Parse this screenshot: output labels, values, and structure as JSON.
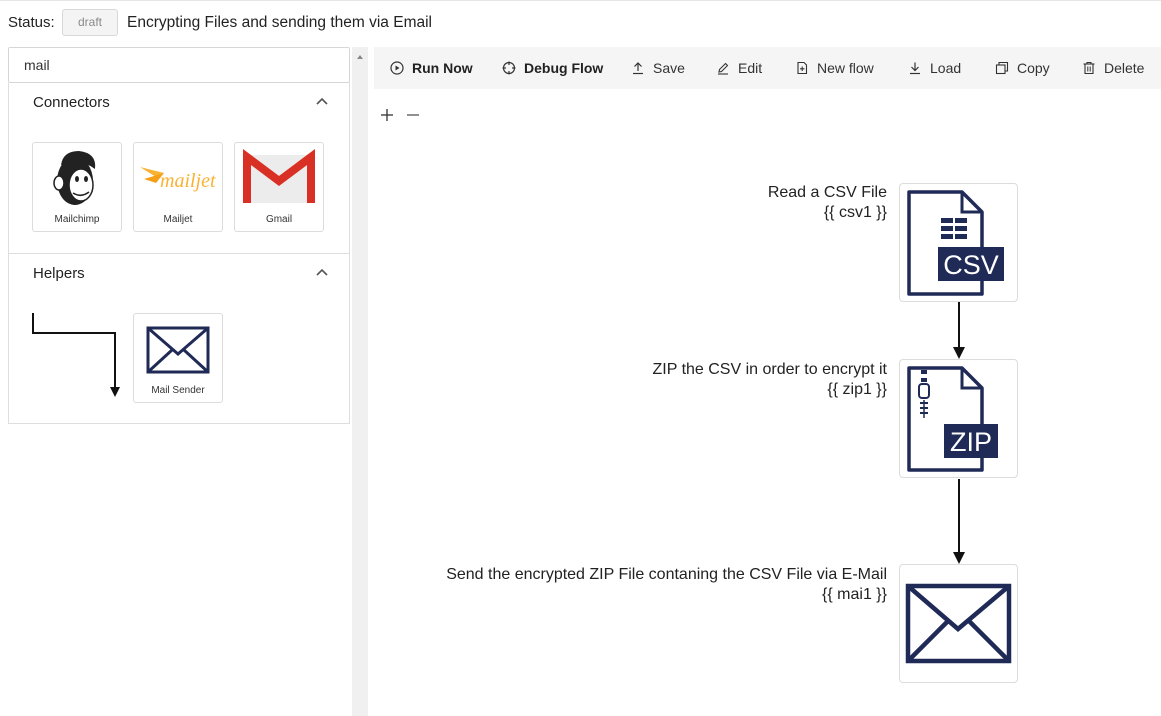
{
  "header": {
    "status_label": "Status:",
    "status_value": "draft",
    "flow_title": "Encrypting Files and sending them via Email"
  },
  "sidebar": {
    "search_value": "mail",
    "sections": [
      {
        "title": "Connectors",
        "items": [
          {
            "label": "Mailchimp",
            "icon": "mailchimp-logo"
          },
          {
            "label": "Mailjet",
            "icon": "mailjet-logo",
            "logo_text": "mailjet"
          },
          {
            "label": "Gmail",
            "icon": "gmail-logo"
          }
        ]
      },
      {
        "title": "Helpers",
        "items": [
          {
            "label": "Mail Sender",
            "icon": "envelope-icon"
          }
        ]
      }
    ]
  },
  "toolbar": {
    "run_now": "Run Now",
    "debug_flow": "Debug Flow",
    "save": "Save",
    "edit": "Edit",
    "new_flow": "New flow",
    "load": "Load",
    "copy": "Copy",
    "delete": "Delete"
  },
  "canvas": {
    "nodes": [
      {
        "title": "Read a CSV File",
        "ref": "{{ csv1 }}",
        "icon": "csv-file-icon",
        "badge": "CSV"
      },
      {
        "title": "ZIP the CSV in order to encrypt it",
        "ref": "{{ zip1 }}",
        "icon": "zip-file-icon",
        "badge": "ZIP"
      },
      {
        "title": "Send the encrypted ZIP File contaning the CSV File via E-Mail",
        "ref": "{{ mai1 }}",
        "icon": "envelope-icon"
      }
    ]
  },
  "colors": {
    "navy": "#1f2a56",
    "gmail_red": "#d93025",
    "mailjet_yellow": "#f9b233",
    "toolbar_bg": "#f5f5f5"
  }
}
